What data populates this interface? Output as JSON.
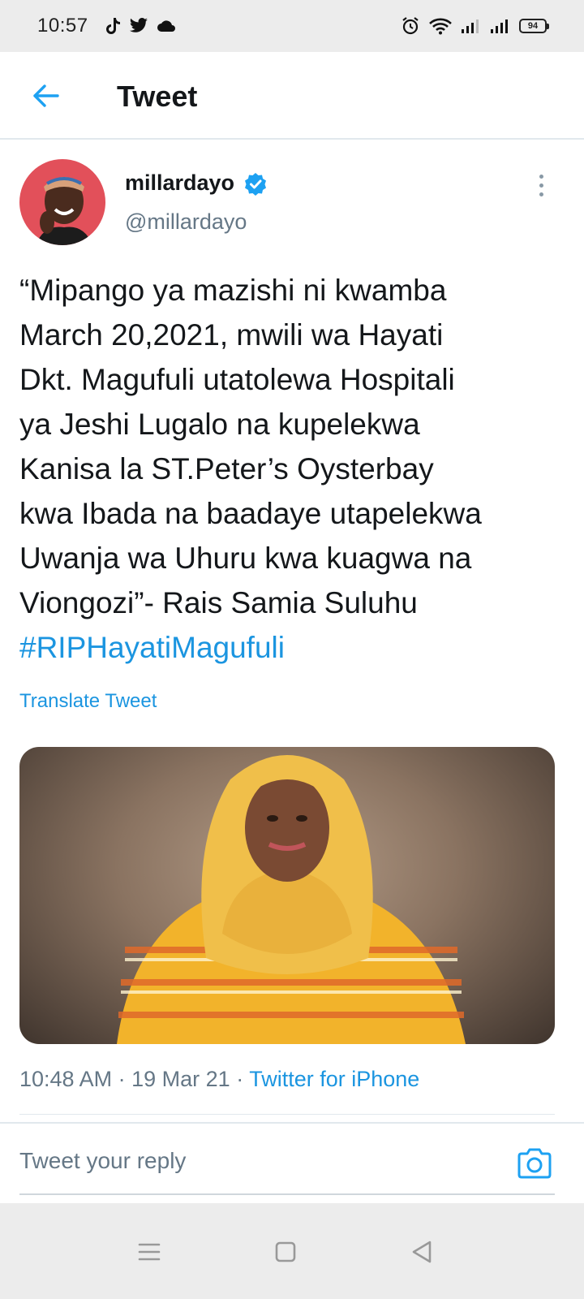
{
  "status_bar": {
    "time": "10:57",
    "battery": "94",
    "icons": [
      "tiktok-icon",
      "twitter-icon",
      "cloud-icon",
      "alarm-icon",
      "wifi-icon",
      "signal-icon",
      "signal-icon",
      "battery-icon"
    ]
  },
  "header": {
    "title": "Tweet",
    "back_icon": "arrow-left-icon",
    "accent_color": "#1da1f2"
  },
  "tweet": {
    "author_name": "millardayo",
    "author_handle": "@millardayo",
    "verified": true,
    "text_lines": [
      "“Mipango ya mazishi ni kwamba",
      "March 20,2021, mwili wa Hayati",
      "Dkt. Magufuli utatolewa Hospitali",
      "ya Jeshi Lugalo na kupelekwa",
      "Kanisa la ST.Peter’s Oysterbay",
      "kwa Ibada na baadaye utapelekwa",
      "Uwanja wa Uhuru kwa kuagwa na",
      "Viongozi”- Rais Samia Suluhu"
    ],
    "hashtag": "#RIPHayatiMagufuli",
    "translate_label": "Translate Tweet",
    "time": "10:48 AM",
    "separator": "·",
    "date": "19 Mar 21",
    "source": "Twitter for iPhone",
    "link_color": "#1b95e0"
  },
  "reply": {
    "placeholder": "Tweet your reply",
    "camera_icon": "camera-icon"
  },
  "nav_bar": {
    "icons": [
      "menu-icon",
      "home-square-icon",
      "back-triangle-icon"
    ]
  }
}
